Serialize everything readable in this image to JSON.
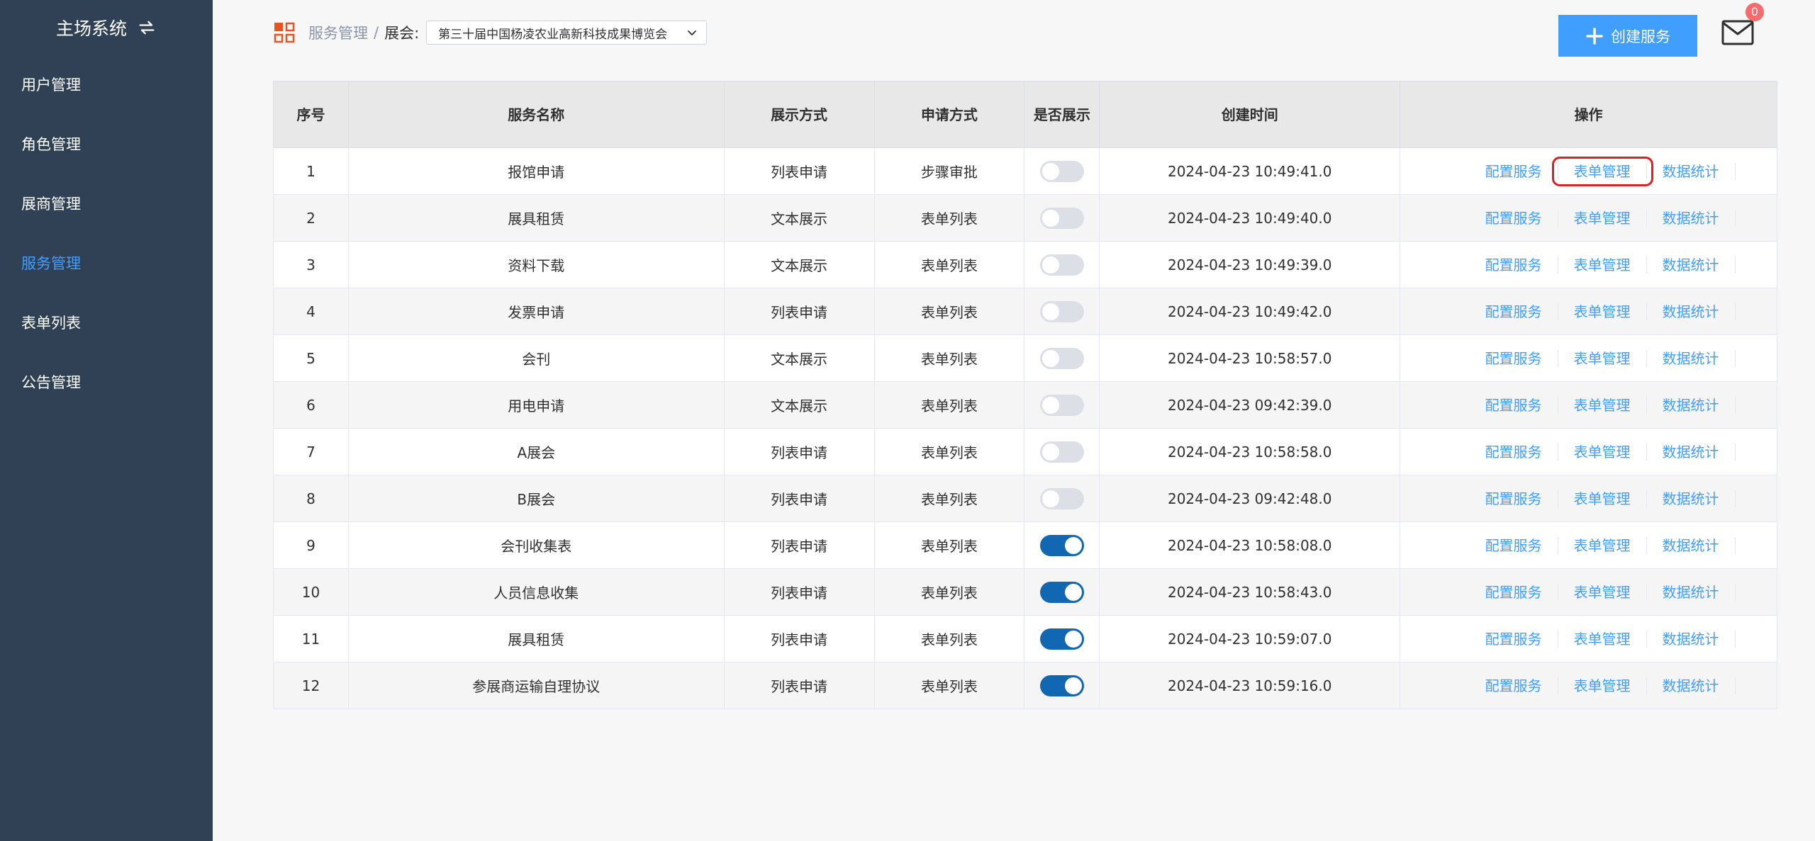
{
  "sidebar": {
    "brand": "主场系统",
    "items": [
      {
        "label": "用户管理",
        "active": false
      },
      {
        "label": "角色管理",
        "active": false
      },
      {
        "label": "展商管理",
        "active": false
      },
      {
        "label": "服务管理",
        "active": true
      },
      {
        "label": "表单列表",
        "active": false
      },
      {
        "label": "公告管理",
        "active": false
      }
    ]
  },
  "header": {
    "breadcrumb": "服务管理",
    "separator": "/",
    "expo_label": "展会:",
    "expo_selected": "第三十届中国杨凌农业高新科技成果博览会",
    "create_button": "创建服务",
    "mail_count": "0"
  },
  "table": {
    "headers": [
      "序号",
      "服务名称",
      "展示方式",
      "申请方式",
      "是否展示",
      "创建时间",
      "操作"
    ],
    "actions": [
      "配置服务",
      "表单管理",
      "数据统计"
    ],
    "rows": [
      {
        "no": "1",
        "name": "报馆申请",
        "display": "列表申请",
        "apply": "步骤审批",
        "shown": false,
        "created": "2024-04-23 10:49:41.0"
      },
      {
        "no": "2",
        "name": "展具租赁",
        "display": "文本展示",
        "apply": "表单列表",
        "shown": false,
        "created": "2024-04-23 10:49:40.0"
      },
      {
        "no": "3",
        "name": "资料下载",
        "display": "文本展示",
        "apply": "表单列表",
        "shown": false,
        "created": "2024-04-23 10:49:39.0"
      },
      {
        "no": "4",
        "name": "发票申请",
        "display": "列表申请",
        "apply": "表单列表",
        "shown": false,
        "created": "2024-04-23 10:49:42.0"
      },
      {
        "no": "5",
        "name": "会刊",
        "display": "文本展示",
        "apply": "表单列表",
        "shown": false,
        "created": "2024-04-23 10:58:57.0"
      },
      {
        "no": "6",
        "name": "用电申请",
        "display": "文本展示",
        "apply": "表单列表",
        "shown": false,
        "created": "2024-04-23 09:42:39.0"
      },
      {
        "no": "7",
        "name": "A展会",
        "display": "列表申请",
        "apply": "表单列表",
        "shown": false,
        "created": "2024-04-23 10:58:58.0"
      },
      {
        "no": "8",
        "name": "B展会",
        "display": "列表申请",
        "apply": "表单列表",
        "shown": false,
        "created": "2024-04-23 09:42:48.0"
      },
      {
        "no": "9",
        "name": "会刊收集表",
        "display": "列表申请",
        "apply": "表单列表",
        "shown": true,
        "created": "2024-04-23 10:58:08.0"
      },
      {
        "no": "10",
        "name": "人员信息收集",
        "display": "列表申请",
        "apply": "表单列表",
        "shown": true,
        "created": "2024-04-23 10:58:43.0"
      },
      {
        "no": "11",
        "name": "展具租赁",
        "display": "列表申请",
        "apply": "表单列表",
        "shown": true,
        "created": "2024-04-23 10:59:07.0"
      },
      {
        "no": "12",
        "name": "参展商运输自理协议",
        "display": "列表申请",
        "apply": "表单列表",
        "shown": true,
        "created": "2024-04-23 10:59:16.0"
      }
    ]
  },
  "colors": {
    "sidebar_bg": "#304156",
    "accent": "#409eff",
    "toggle_on": "#1167b1",
    "highlight": "#e02020"
  }
}
